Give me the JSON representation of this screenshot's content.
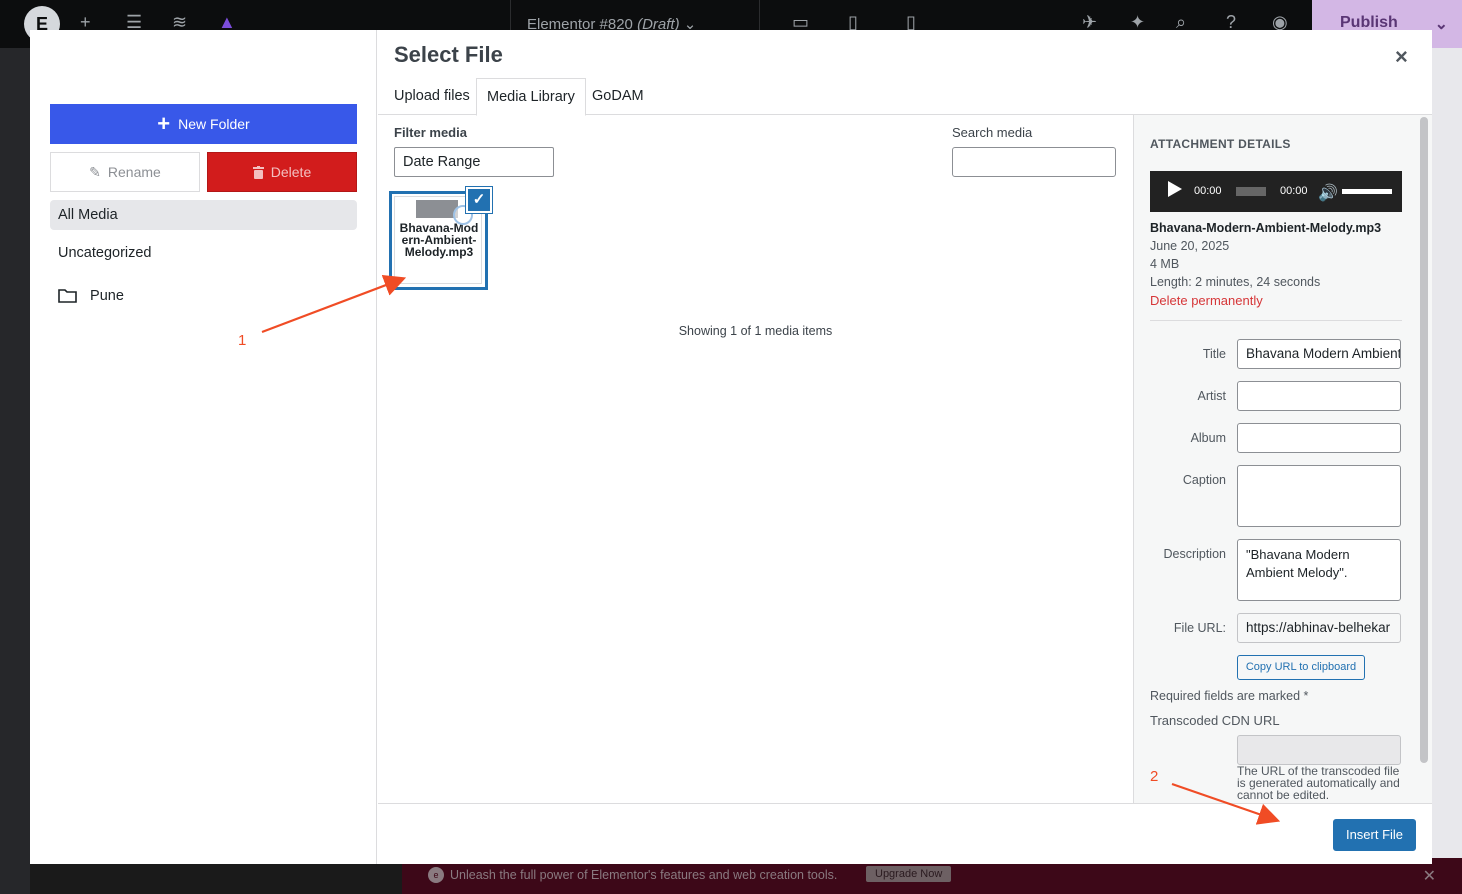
{
  "editor": {
    "logo": "E",
    "doc_title": "Elementor #820",
    "doc_status": "(Draft)",
    "publish_label": "Publish",
    "promo_text": "Unleash the full power of Elementor's features and web creation tools.",
    "upgrade_label": "Upgrade Now"
  },
  "folders": {
    "new_folder_label": "New Folder",
    "rename_label": "Rename",
    "delete_label": "Delete",
    "items": [
      {
        "label": "All Media",
        "active": true
      },
      {
        "label": "Uncategorized",
        "active": false
      },
      {
        "label": "Pune",
        "active": false
      }
    ]
  },
  "modal": {
    "title": "Select File",
    "close_icon": "×",
    "tabs": [
      "Upload files",
      "Media Library",
      "GoDAM"
    ],
    "active_tab": "Media Library"
  },
  "library": {
    "filter_label": "Filter media",
    "date_select": "Date Range",
    "search_label": "Search media",
    "search_value": "",
    "items": [
      {
        "name": "Bhavana-Modern-Ambient-Melody.mp3",
        "selected": true
      }
    ],
    "showing": "Showing 1 of 1 media items"
  },
  "details": {
    "heading": "ATTACHMENT DETAILS",
    "player": {
      "current": "00:00",
      "duration": "00:00"
    },
    "filename": "Bhavana-Modern-Ambient-Melody.mp3",
    "date": "June 20, 2025",
    "size": "4 MB",
    "length": "Length: 2 minutes, 24 seconds",
    "delete_label": "Delete permanently",
    "fields": {
      "title_label": "Title",
      "title_value": "Bhavana Modern Ambient Melody",
      "artist_label": "Artist",
      "artist_value": "",
      "album_label": "Album",
      "album_value": "",
      "caption_label": "Caption",
      "caption_value": "",
      "description_label": "Description",
      "description_value": "\"Bhavana Modern Ambient Melody\".",
      "url_label": "File URL:",
      "url_value": "https://abhinav-belhekar"
    },
    "copy_label": "Copy URL to clipboard",
    "required_note": "Required fields are marked *",
    "cdn_label": "Transcoded CDN URL",
    "cdn_help": "The URL of the transcoded file is generated automatically and cannot be edited."
  },
  "footer": {
    "insert_label": "Insert File"
  },
  "annotations": {
    "one": "1",
    "two": "2"
  },
  "colors": {
    "primary_blue": "#3858e9",
    "wp_blue": "#2271b1",
    "danger_red": "#d21c1c",
    "annotation": "#f04c25",
    "publish_bg": "#d3b7e5"
  }
}
